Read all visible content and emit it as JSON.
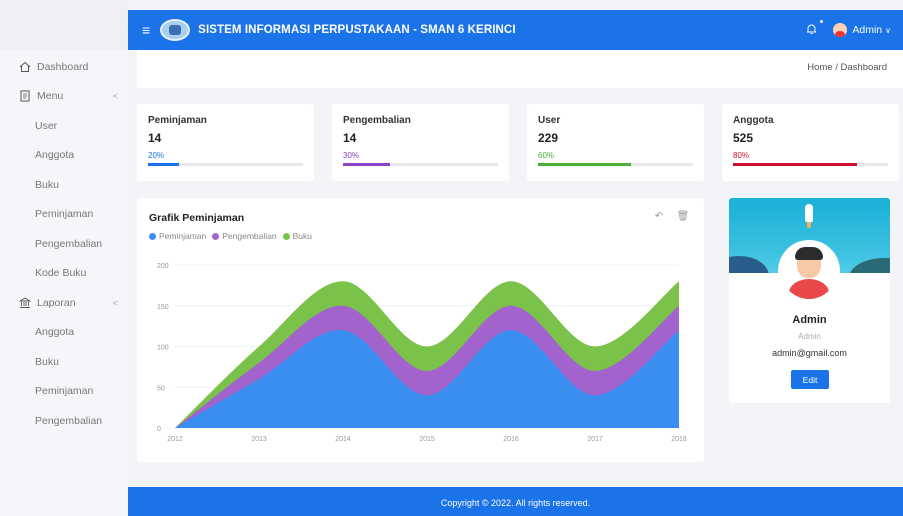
{
  "header": {
    "title": "SISTEM INFORMASI PERPUSTAKAAN - SMAN 6 KERINCI",
    "user_label": "Admin",
    "user_chevron": "∨"
  },
  "sidebar": {
    "dashboard": "Dashboard",
    "menu": "Menu",
    "menu_items": [
      "User",
      "Anggota",
      "Buku",
      "Peminjaman",
      "Pengembalian",
      "Kode Buku"
    ],
    "laporan": "Laporan",
    "laporan_items": [
      "Anggota",
      "Buku",
      "Peminjaman",
      "Pengembalian"
    ]
  },
  "breadcrumb": "Home / Dashboard",
  "stats": [
    {
      "label": "Peminjaman",
      "value": "14",
      "percent_label": "20%",
      "percent": 20,
      "color": "#1a73e8"
    },
    {
      "label": "Pengembalian",
      "value": "14",
      "percent_label": "30%",
      "percent": 30,
      "color": "#8e44c9"
    },
    {
      "label": "User",
      "value": "229",
      "percent_label": "60%",
      "percent": 60,
      "color": "#4caf35"
    },
    {
      "label": "Anggota",
      "value": "525",
      "percent_label": "80%",
      "percent": 80,
      "color": "#d0102c"
    }
  ],
  "chart": {
    "title": "Grafik Peminjaman",
    "tools": [
      "↶",
      "🗑"
    ]
  },
  "chart_data": {
    "type": "area",
    "stacked": true,
    "x": [
      "2012",
      "2013",
      "2014",
      "2015",
      "2016",
      "2017",
      "2018"
    ],
    "ylim": [
      0,
      200
    ],
    "yticks": [
      0,
      50,
      100,
      150,
      200
    ],
    "series": [
      {
        "name": "Peminjaman",
        "color": "#3a8ef0",
        "values": [
          0,
          60,
          120,
          40,
          120,
          40,
          120
        ]
      },
      {
        "name": "Pengembalian",
        "color": "#a264cc",
        "values": [
          0,
          20,
          30,
          30,
          30,
          30,
          30
        ]
      },
      {
        "name": "Buku",
        "color": "#7bc24a",
        "values": [
          0,
          20,
          30,
          30,
          30,
          30,
          30
        ]
      }
    ],
    "legend": "top-left",
    "grid": true
  },
  "profile": {
    "name": "Admin",
    "role": "Admin",
    "email": "admin@gmail.com",
    "edit_label": "Edit"
  },
  "footer": "Copyright © 2022. All rights reserved."
}
